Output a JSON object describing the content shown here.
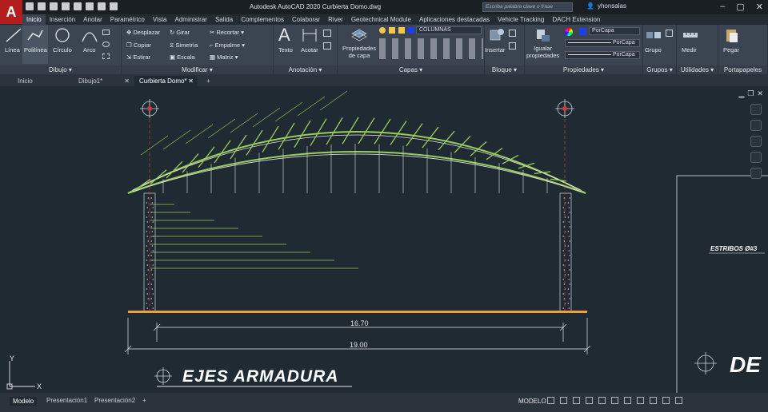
{
  "app": {
    "logo": "A",
    "title": "Autodesk AutoCAD 2020    Curbierta Domo.dwg",
    "search_placeholder": "Escriba palabra clave o frase",
    "user": "yhonsalas"
  },
  "menu": [
    "Inicio",
    "Inserción",
    "Anotar",
    "Paramétrico",
    "Vista",
    "Administrar",
    "Salida",
    "Complementos",
    "Colaborar",
    "River",
    "Geotechnical Module",
    "Aplicaciones destacadas",
    "Vehicle Tracking",
    "DACH Extension"
  ],
  "ribbon": {
    "dibujo": {
      "label": "Dibujo ▾",
      "linea": "Línea",
      "polilinea": "Polilínea",
      "circulo": "Círculo",
      "arco": "Arco"
    },
    "modificar": {
      "label": "Modificar ▾",
      "desplazar": "Desplazar",
      "girar": "Girar",
      "recortar": "Recortar ▾",
      "copiar": "Copiar",
      "simetria": "Simetría",
      "empalme": "Empalme ▾",
      "estirar": "Estirar",
      "escala": "Escala",
      "matriz": "Matriz ▾"
    },
    "anotacion": {
      "label": "Anotación ▾",
      "texto": "Texto",
      "acotar": "Acotar"
    },
    "capas": {
      "label": "Capas ▾",
      "props": "Propiedades\nde capa",
      "layer": "COLUMNAS"
    },
    "bloque": {
      "label": "Bloque ▾",
      "insertar": "Insertar"
    },
    "propiedades": {
      "label": "Propiedades ▾",
      "igualar": "Igualar\npropiedades",
      "porcapa1": "PorCapa",
      "porcapa2": "PorCapa",
      "porcapa3": "PorCapa"
    },
    "grupos": {
      "label": "Grupos ▾",
      "grupo": "Grupo"
    },
    "utilidades": {
      "label": "Utilidades ▾",
      "medir": "Medir"
    },
    "portapapeles": {
      "label": "Portapapeles",
      "pegar": "Pegar"
    }
  },
  "tabs": [
    "Inicio",
    "Dibujo1*",
    "Curbierta Domo*"
  ],
  "drawing": {
    "dim_inner": "16.70",
    "dim_outer": "19.00",
    "title": "EJES  ARMADURA",
    "label_right": "ESTRIBOS Ø#3",
    "label_de": "DE",
    "ucs_y": "Y",
    "ucs_x": "X"
  },
  "layouts": [
    "Modelo",
    "Presentación1",
    "Presentación2"
  ],
  "status": {
    "mode": "MODELO"
  }
}
